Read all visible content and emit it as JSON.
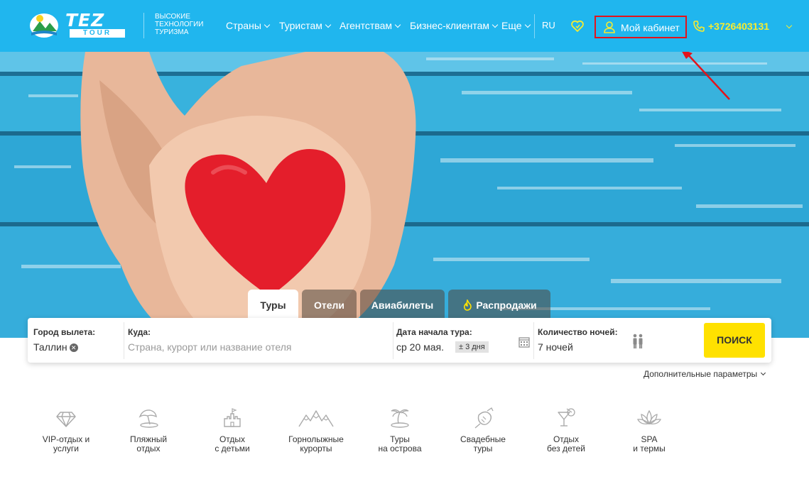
{
  "header": {
    "logo_text_top": "TEZ",
    "logo_text_bottom": "TOUR",
    "slogan": [
      "ВЫСОКИЕ",
      "ТЕХНОЛОГИИ",
      "ТУРИЗМА"
    ],
    "nav": [
      {
        "label": "Страны"
      },
      {
        "label": "Туристам"
      },
      {
        "label": "Агентствам"
      },
      {
        "label": "Бизнес-клиентам"
      },
      {
        "label": "Еще"
      }
    ],
    "language": "RU",
    "cabinet_label": "Мой кабинет",
    "phone": "+3726403131"
  },
  "tabs": [
    {
      "label": "Туры",
      "active": true
    },
    {
      "label": "Отели",
      "active": false
    },
    {
      "label": "Авиабилеты",
      "active": false
    },
    {
      "label": "Распродажи",
      "active": false
    }
  ],
  "search": {
    "departure_label": "Город вылета:",
    "departure_value": "Таллин",
    "destination_label": "Куда:",
    "destination_placeholder": "Страна, курорт или название отеля",
    "date_label": "Дата начала тура:",
    "date_value": "ср 20 мая.",
    "date_flex": "± 3 дня",
    "nights_label": "Количество ночей:",
    "nights_value": "7 ночей",
    "button": "ПОИСК"
  },
  "more_params": "Дополнительные параметры",
  "categories": [
    {
      "icon": "diamond-icon",
      "lines": [
        "VIP-отдых и",
        "услуги"
      ]
    },
    {
      "icon": "beach-umbrella-icon",
      "lines": [
        "Пляжный",
        "отдых"
      ]
    },
    {
      "icon": "sandcastle-icon",
      "lines": [
        "Отдых",
        "с детьми"
      ]
    },
    {
      "icon": "mountains-icon",
      "lines": [
        "Горнолыжные",
        "курорты"
      ]
    },
    {
      "icon": "palm-island-icon",
      "lines": [
        "Туры",
        "на острова"
      ]
    },
    {
      "icon": "wedding-cake-icon",
      "lines": [
        "Свадебные",
        "туры"
      ]
    },
    {
      "icon": "cocktail-icon",
      "lines": [
        "Отдых",
        "без детей"
      ]
    },
    {
      "icon": "lotus-icon",
      "lines": [
        "SPA",
        "и термы"
      ]
    }
  ],
  "colors": {
    "header_bg": "#20b6ee",
    "phone": "#f7ec2f",
    "search_button": "#ffe100",
    "highlight_border": "#e3131b",
    "heart": "#e41e2b"
  }
}
